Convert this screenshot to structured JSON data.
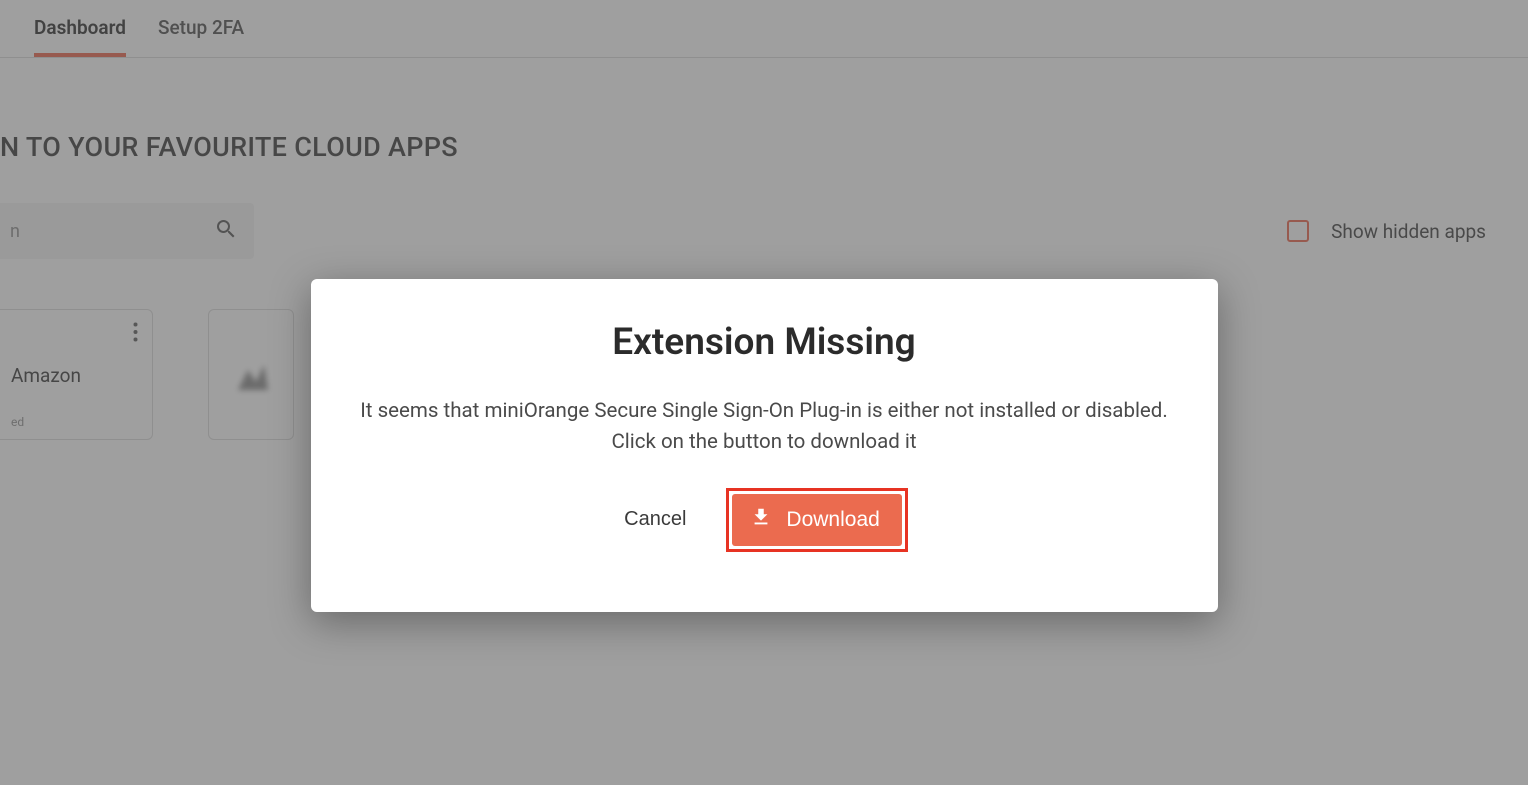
{
  "tabs": {
    "dashboard": "Dashboard",
    "setup2fa": "Setup 2FA"
  },
  "heading": "N TO YOUR FAVOURITE CLOUD APPS",
  "search": {
    "trailing_char": "n"
  },
  "show_hidden_label": "Show hidden apps",
  "card": {
    "title": "Amazon",
    "sub": "ed"
  },
  "modal": {
    "title": "Extension Missing",
    "message_line1": "It seems that miniOrange Secure Single Sign-On Plug-in is either not installed or disabled.",
    "message_line2": "Click on the button to download it",
    "cancel": "Cancel",
    "download": "Download"
  }
}
